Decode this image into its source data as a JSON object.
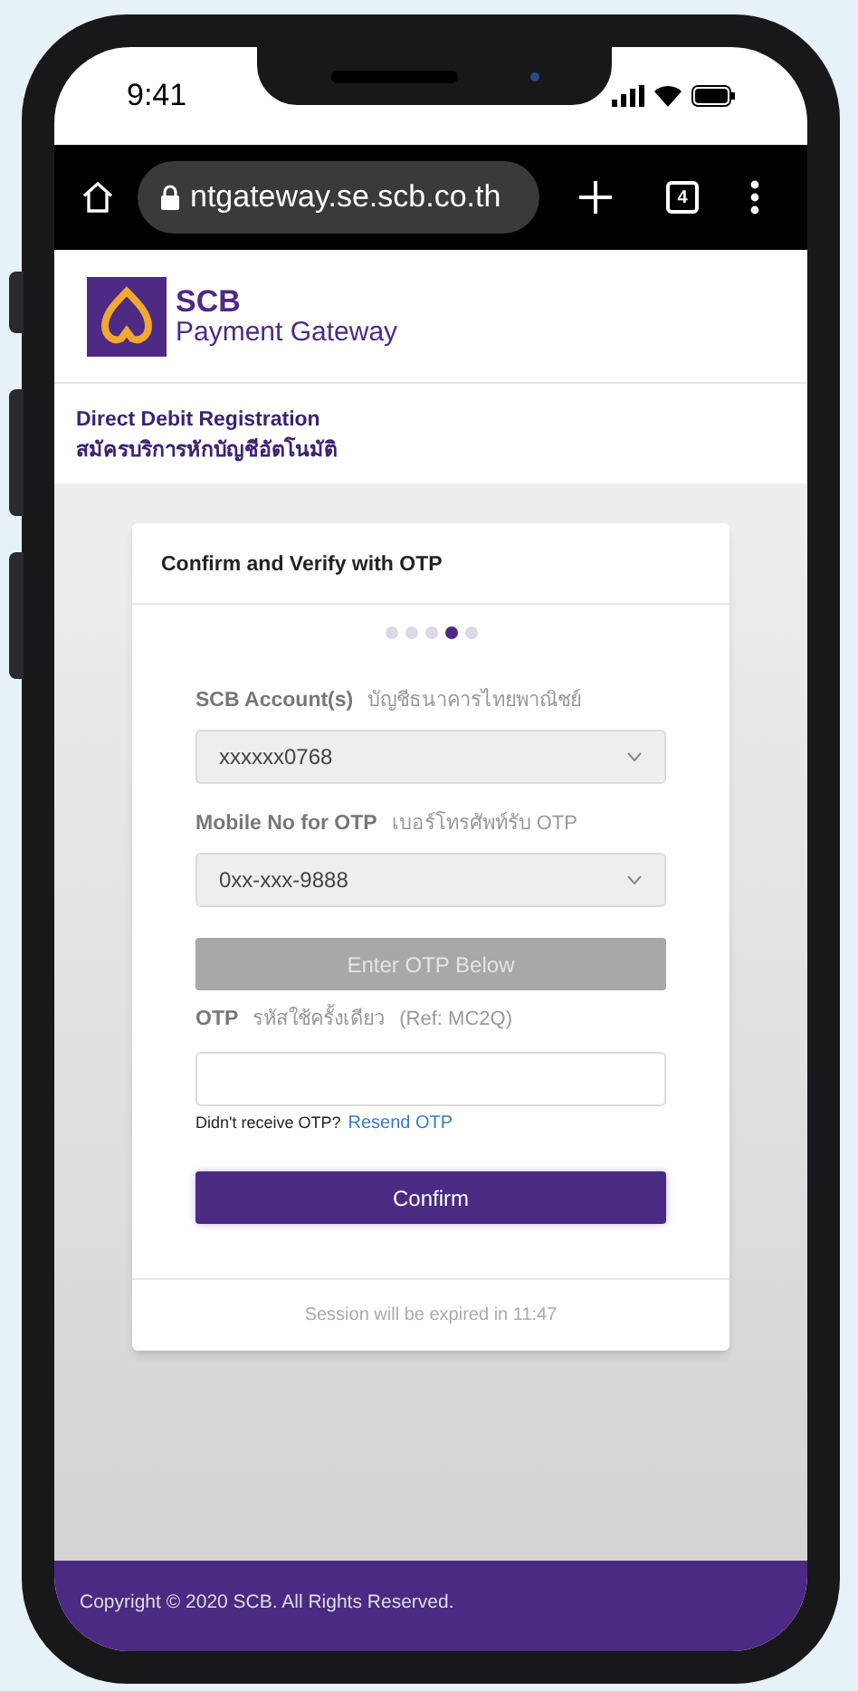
{
  "status_bar": {
    "time": "9:41"
  },
  "browser": {
    "url": "ntgateway.se.scb.co.th",
    "tab_count": "4"
  },
  "header": {
    "brand": "SCB",
    "subtitle": "Payment Gateway"
  },
  "page_title": {
    "english": "Direct Debit Registration",
    "thai": "สมัครบริการหักบัญชีอัตโนมัติ"
  },
  "card": {
    "title": "Confirm and Verify with OTP",
    "steps": [
      {
        "selected": false
      },
      {
        "selected": false
      },
      {
        "selected": false
      },
      {
        "selected": true
      },
      {
        "selected": false
      }
    ],
    "fields": [
      {
        "label": "SCB Account(s)",
        "thai_label": "บัญชีธนาคารไทยพาณิชย์",
        "value": "xxxxxx0768"
      },
      {
        "label": "Mobile No for OTP",
        "thai_label": "เบอร์โทรศัพท์รับ OTP",
        "value": "0xx-xxx-9888"
      }
    ],
    "otp_banner": {
      "label": "Enter OTP Below",
      "disabled": true
    },
    "otp": {
      "label": "OTP",
      "thai_label": "รหัสใช้ครั้งเดียว",
      "ref": "(Ref: MC2Q)"
    },
    "resend": {
      "prompt": "Didn't receive OTP?",
      "link": "Resend OTP"
    },
    "confirm_button": "Confirm",
    "session_note": "Session will be expired in 11:47"
  },
  "footer": "Copyright © 2020 SCB. All Rights Reserved."
}
